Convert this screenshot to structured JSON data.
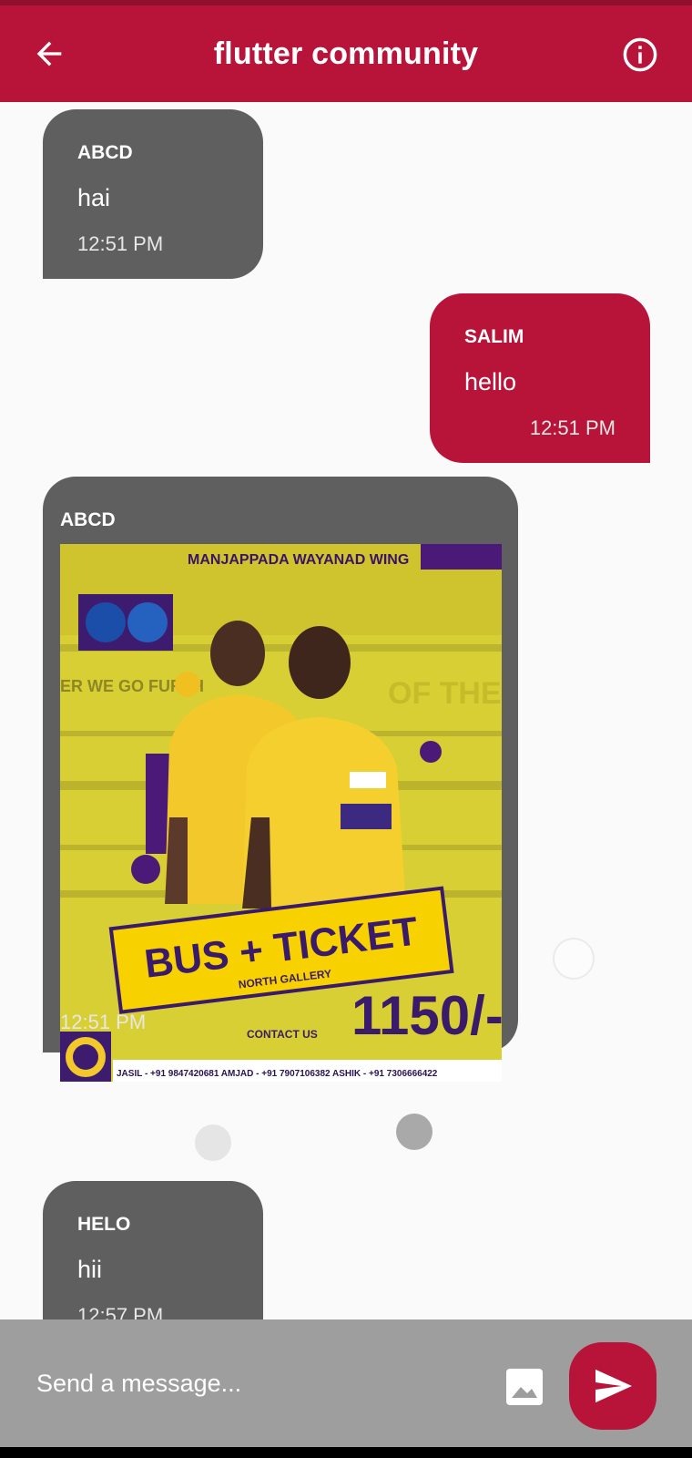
{
  "app": {
    "title": "flutter community",
    "back_icon": "arrow-left-icon",
    "info_icon": "info-circle-icon"
  },
  "colors": {
    "primary": "#b8143a",
    "incoming_bubble": "#5f5f5f",
    "background": "#fafafa",
    "composer": "#9e9e9e"
  },
  "messages": [
    {
      "sender": "ABCD",
      "text": "hai",
      "time": "12:51 PM",
      "direction": "incoming"
    },
    {
      "sender": "SALIM",
      "text": "hello",
      "time": "12:51 PM",
      "direction": "outgoing"
    },
    {
      "sender": "ABCD",
      "type": "image",
      "time": "12:51 PM",
      "direction": "incoming",
      "image": {
        "header": "MANJAPPADA WAYANAD WING",
        "headline": "BUS + TICKET",
        "subline": "NORTH GALLERY",
        "price": "1150/-",
        "contact_label": "CONTACT US",
        "contacts": "JASIL - +91 9847420681   AMJAD - +91 7907106382   ASHIK - +91 7306666422",
        "background_text_1": "ER WE GO FURTH",
        "background_text_2": "OF THE"
      }
    },
    {
      "sender": "HELO",
      "text": "hii",
      "time": "12:57 PM",
      "direction": "incoming"
    }
  ],
  "composer": {
    "placeholder": "Send a message...",
    "image_icon": "image-icon",
    "send_icon": "send-icon"
  }
}
